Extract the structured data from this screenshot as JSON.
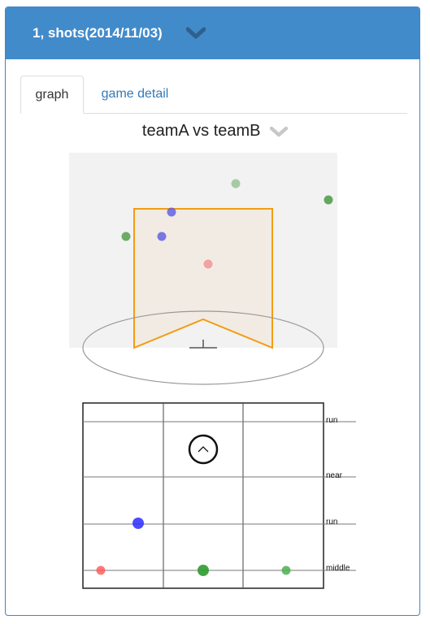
{
  "header": {
    "title": "1, shots(2014/11/03)",
    "chevron_icon": "chevron-down-icon"
  },
  "tabs": [
    {
      "label": "graph",
      "active": true
    },
    {
      "label": "game detail",
      "active": false
    }
  ],
  "match": {
    "title": "teamA vs teamB",
    "chevron_icon": "chevron-down-icon"
  },
  "goal_view": {
    "background": "#f2f2f2",
    "goal_fill": "#f2ebe3",
    "goal_stroke": "#f39c12",
    "shots": [
      {
        "color": "#6aaa64",
        "opacity": 0.55
      },
      {
        "color": "#4a9a44",
        "opacity": 0.85
      },
      {
        "color": "#5a5ae0",
        "opacity": 0.8
      },
      {
        "color": "#4a9a44",
        "opacity": 0.8
      },
      {
        "color": "#5a5ae0",
        "opacity": 0.8
      },
      {
        "color": "#f28a8a",
        "opacity": 0.75
      }
    ]
  },
  "court_view": {
    "row_labels": [
      "run",
      "near",
      "run",
      "middle"
    ],
    "player_marker": "chevron-up-icon",
    "shots": [
      {
        "color": "#2b2bff",
        "opacity": 0.85
      },
      {
        "color": "#ff5555",
        "opacity": 0.8
      },
      {
        "color": "#2e9b2e",
        "opacity": 0.9
      },
      {
        "color": "#4caf50",
        "opacity": 0.85
      }
    ]
  }
}
